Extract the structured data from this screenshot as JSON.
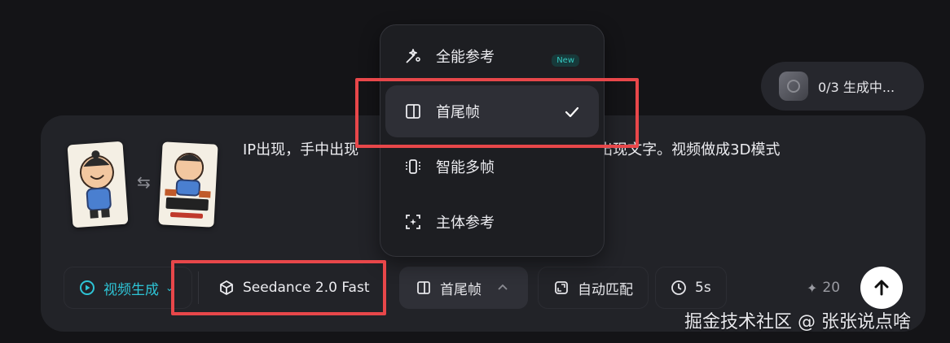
{
  "status": {
    "text": "0/3 生成中..."
  },
  "prompt": {
    "text_visible_left": "IP出现，手中出现",
    "text_visible_right": "方出现文字。视频做成3D模式"
  },
  "toolbar": {
    "mode_label": "视频生成",
    "model_label": "Seedance 2.0 Fast",
    "frame_label": "首尾帧",
    "ratio_label": "自动匹配",
    "duration_label": "5s",
    "credits": "20"
  },
  "menu": {
    "items": [
      {
        "label": "全能参考",
        "icon": "wand-icon",
        "badge": "New"
      },
      {
        "label": "首尾帧",
        "icon": "frame-icon",
        "selected": true
      },
      {
        "label": "智能多帧",
        "icon": "multi-frame-icon"
      },
      {
        "label": "主体参考",
        "icon": "subject-icon"
      }
    ]
  },
  "watermark": "掘金技术社区 @ 张张说点啥",
  "colors": {
    "accent": "#2ec4d6",
    "highlight": "#e8474a",
    "background": "#141417",
    "card": "#222328"
  }
}
